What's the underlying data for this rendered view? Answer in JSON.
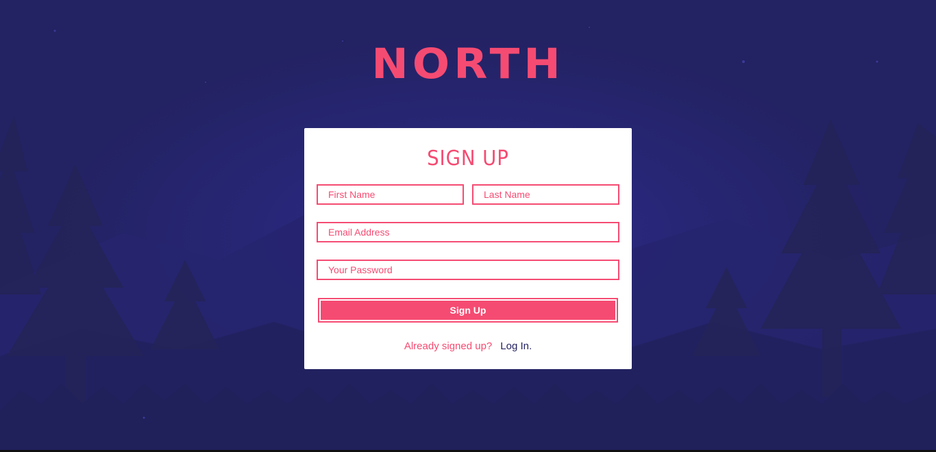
{
  "brand": {
    "logo_text": "NORTH"
  },
  "form": {
    "title": "SIGN UP",
    "first_name_placeholder": "First Name",
    "last_name_placeholder": "Last Name",
    "email_placeholder": "Email Address",
    "password_placeholder": "Your Password",
    "submit_label": "Sign Up",
    "already_text": "Already signed up?",
    "login_link_text": "Log In."
  },
  "colors": {
    "background": "#232262",
    "accent": "#f54b72",
    "card": "#ffffff",
    "link": "#232262"
  }
}
